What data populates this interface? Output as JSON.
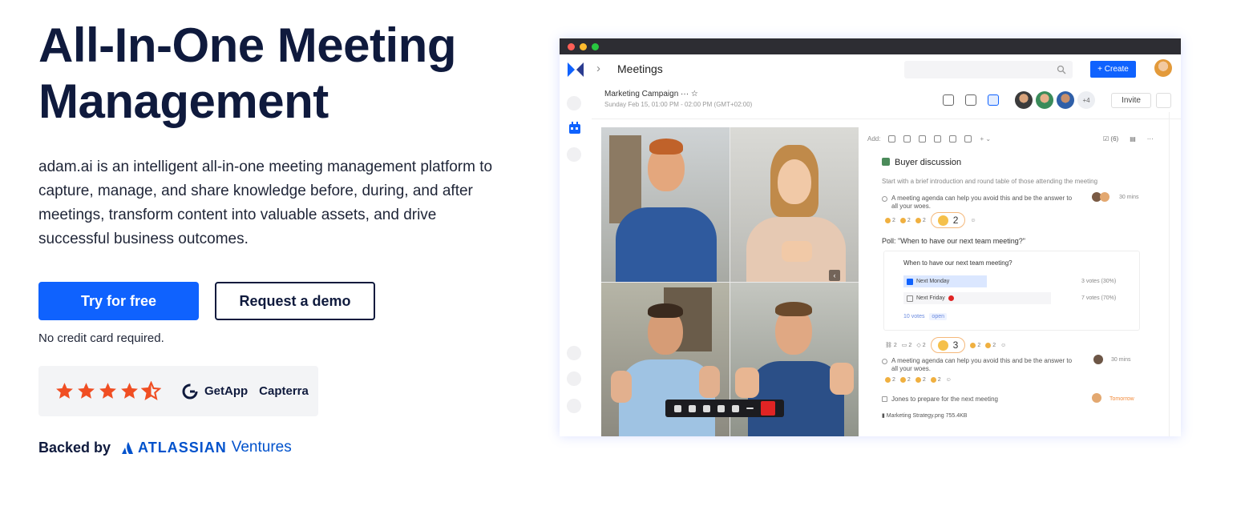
{
  "hero": {
    "title": "All-In-One Meeting Management",
    "description": "adam.ai is an intelligent all-in-one meeting management platform to capture, manage, and share knowledge before, during, and after meetings, transform content into valuable assets, and drive successful business outcomes.",
    "primary_cta": "Try for free",
    "secondary_cta": "Request a demo",
    "note": "No credit card required."
  },
  "ratings": {
    "stars": 4.5,
    "star_color": "#f04e23",
    "getapp": "GetApp",
    "capterra": "Capterra"
  },
  "backed": {
    "label": "Backed by",
    "company": "ATLASSIAN",
    "suffix": "Ventures",
    "brand_color": "#0052cc"
  },
  "app": {
    "nav_title": "Meetings",
    "create_label": "+ Create",
    "meeting_title": "Marketing Campaign ··· ☆",
    "meeting_time": "Sunday Feb 15, 01:00 PM - 02:00 PM (GMT+02:00)",
    "extra_participants": "+4",
    "invite_label": "Invite",
    "toolbar_add": "Add:",
    "task_count": "(6)",
    "section_title": "Buyer discussion",
    "section_intro": "Start with a brief introduction and round table of those attending the meeting",
    "agenda_text": "A meeting agenda can help you avoid this and be the answer to all your woes.",
    "agenda_duration_1": "30 mins",
    "reaction_count_1": "2",
    "poll_title": "Poll: \"When to have our next team meeting?\"",
    "poll_question": "When to have our next team meeting?",
    "poll_options": [
      {
        "label": "Next Monday",
        "votes": "3 votes (30%)"
      },
      {
        "label": "Next Friday",
        "votes": "7 votes (70%)"
      }
    ],
    "poll_total": "10 votes",
    "poll_status": "open",
    "reaction_count_2": "3",
    "agenda_duration_2": "30 mins",
    "task_text": "Jones to prepare for the next meeting",
    "task_due": "Tomorrow",
    "attachment": "Marketing Strategy.png  755.4KB",
    "chip_value": "2"
  },
  "colors": {
    "primary": "#0f62fe",
    "heading": "#0f1a3d",
    "due": "#f28b3c"
  }
}
